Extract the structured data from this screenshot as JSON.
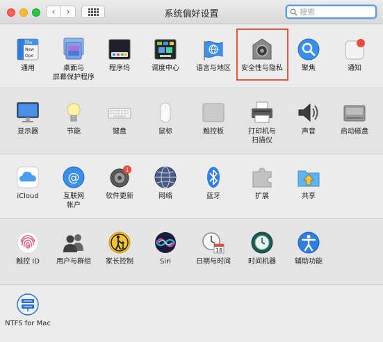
{
  "window": {
    "title": "系统偏好设置"
  },
  "search": {
    "placeholder": "搜索"
  },
  "colors": {
    "highlight": "#e0583f",
    "accent": "#2d7fe0"
  },
  "row1": [
    {
      "label": "通用",
      "icon": "general-icon"
    },
    {
      "label": "桌面与\n屏幕保护程序",
      "icon": "desktop-icon"
    },
    {
      "label": "程序坞",
      "icon": "dock-icon"
    },
    {
      "label": "调度中心",
      "icon": "mission-control-icon"
    },
    {
      "label": "语言与地区",
      "icon": "language-icon"
    },
    {
      "label": "安全性与隐私",
      "icon": "security-icon"
    },
    {
      "label": "聚焦",
      "icon": "spotlight-icon"
    },
    {
      "label": "通知",
      "icon": "notifications-icon"
    }
  ],
  "row2": [
    {
      "label": "显示器",
      "icon": "display-icon"
    },
    {
      "label": "节能",
      "icon": "energy-saver-icon"
    },
    {
      "label": "键盘",
      "icon": "keyboard-icon"
    },
    {
      "label": "鼠标",
      "icon": "mouse-icon"
    },
    {
      "label": "触控板",
      "icon": "trackpad-icon"
    },
    {
      "label": "打印机与\n扫描仪",
      "icon": "printer-icon"
    },
    {
      "label": "声音",
      "icon": "sound-icon"
    },
    {
      "label": "启动磁盘",
      "icon": "startup-disk-icon"
    }
  ],
  "row3": [
    {
      "label": "iCloud",
      "icon": "icloud-icon"
    },
    {
      "label": "互联网\n帐户",
      "icon": "internet-accounts-icon"
    },
    {
      "label": "软件更新",
      "icon": "software-update-icon",
      "badge": "1"
    },
    {
      "label": "网络",
      "icon": "network-icon"
    },
    {
      "label": "蓝牙",
      "icon": "bluetooth-icon"
    },
    {
      "label": "扩展",
      "icon": "extensions-icon"
    },
    {
      "label": "共享",
      "icon": "sharing-icon"
    }
  ],
  "row4": [
    {
      "label": "触控 ID",
      "icon": "touch-id-icon"
    },
    {
      "label": "用户与群组",
      "icon": "users-icon"
    },
    {
      "label": "家长控制",
      "icon": "parental-controls-icon"
    },
    {
      "label": "Siri",
      "icon": "siri-icon"
    },
    {
      "label": "日期与时间",
      "icon": "date-time-icon",
      "day": "18"
    },
    {
      "label": "时间机器",
      "icon": "time-machine-icon"
    },
    {
      "label": "辅助功能",
      "icon": "accessibility-icon"
    }
  ],
  "row5": [
    {
      "label": "NTFS for Mac",
      "icon": "ntfs-icon"
    }
  ],
  "general_icon_text": [
    "File",
    "New",
    "Ope"
  ]
}
